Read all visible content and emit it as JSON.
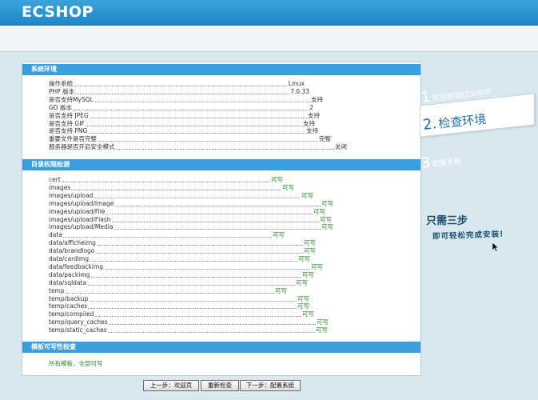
{
  "logo": "ECSHOP",
  "sections": {
    "env_title": "系统环境",
    "dir_title": "目录权限检测",
    "tpl_title": "模板可写性检查"
  },
  "env": [
    {
      "k": "操作系统",
      "v": "Linux"
    },
    {
      "k": "PHP 版本",
      "v": "7.0.33"
    },
    {
      "k": "是否支持MySQL",
      "v": "支持"
    },
    {
      "k": "GD 版本",
      "v": "2"
    },
    {
      "k": "是否支持 JPEG",
      "v": "支持"
    },
    {
      "k": "是否支持 GIF",
      "v": "支持"
    },
    {
      "k": "是否支持 PNG",
      "v": "支持"
    },
    {
      "k": "重要文件是否完整",
      "v": "完整"
    },
    {
      "k": "服务器是否开启安全模式",
      "v": "关闭"
    }
  ],
  "dirs": [
    {
      "k": "cert",
      "v": "可写"
    },
    {
      "k": "images",
      "v": "可写"
    },
    {
      "k": "images/upload",
      "v": "可写"
    },
    {
      "k": "images/upload/Image",
      "v": "可写"
    },
    {
      "k": "images/upload/File",
      "v": "可写"
    },
    {
      "k": "images/upload/Flash",
      "v": "可写"
    },
    {
      "k": "images/upload/Media",
      "v": "可写"
    },
    {
      "k": "data",
      "v": "可写"
    },
    {
      "k": "data/afficheimg",
      "v": "可写"
    },
    {
      "k": "data/brandlogo",
      "v": "可写"
    },
    {
      "k": "data/cardimg",
      "v": "可写"
    },
    {
      "k": "data/feedbackimg",
      "v": "可写"
    },
    {
      "k": "data/packimg",
      "v": "可写"
    },
    {
      "k": "data/sqldata",
      "v": "可写"
    },
    {
      "k": "temp",
      "v": "可写"
    },
    {
      "k": "temp/backup",
      "v": "可写"
    },
    {
      "k": "temp/caches",
      "v": "可写"
    },
    {
      "k": "temp/compiled",
      "v": "可写"
    },
    {
      "k": "temp/query_caches",
      "v": "可写"
    },
    {
      "k": "temp/static_caches",
      "v": "可写"
    }
  ],
  "tpl_note": "所有模板，全部可写",
  "steps": {
    "s1": {
      "n": "1",
      "t": "欢迎使用ECSHOP"
    },
    "s2": {
      "n": "2.",
      "t": "检查环境"
    },
    "s3": {
      "n": "3",
      "t": "配置系统"
    }
  },
  "promo": {
    "line1": "只需三步",
    "line2": "即可轻松完成安装!"
  },
  "buttons": {
    "prev": "上一步：欢迎页",
    "recheck": "重新检查",
    "next": "下一步：配置系统"
  }
}
